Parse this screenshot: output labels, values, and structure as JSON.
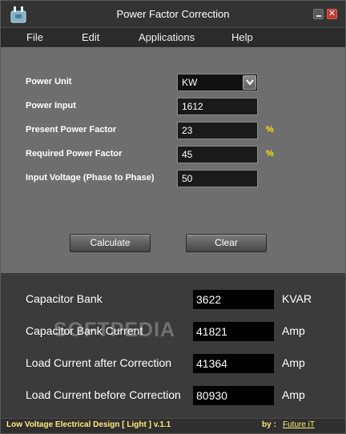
{
  "window": {
    "title": "Power Factor Correction"
  },
  "menu": {
    "items": [
      "File",
      "Edit",
      "Applications",
      "Help"
    ]
  },
  "inputs": {
    "power_unit": {
      "label": "Power Unit",
      "value": "KW"
    },
    "power_input": {
      "label": "Power Input",
      "value": "1612"
    },
    "present_pf": {
      "label": "Present Power Factor",
      "value": "23",
      "unit": "%"
    },
    "required_pf": {
      "label": "Required Power Factor",
      "value": "45",
      "unit": "%"
    },
    "input_voltage": {
      "label": "Input Voltage (Phase to Phase)",
      "value": "50"
    }
  },
  "buttons": {
    "calculate": "Calculate",
    "clear": "Clear"
  },
  "results": [
    {
      "label": "Capacitor Bank",
      "value": "3622",
      "unit": "KVAR"
    },
    {
      "label": "Capacitor Bank Current",
      "value": "41821",
      "unit": "Amp"
    },
    {
      "label": "Load Current after Correction",
      "value": "41364",
      "unit": "Amp"
    },
    {
      "label": "Load Current before Correction",
      "value": "80930",
      "unit": "Amp"
    }
  ],
  "watermark": "SOFTPEDIA",
  "status": {
    "left": "Low Voltage Electrical Design [ Light ]  v.1.1",
    "by": "by :",
    "link": "Future iT"
  },
  "colors": {
    "accent_yellow": "#ffe400",
    "panel_gray": "#6e6e6e",
    "result_bg": "#3b3b3b",
    "close_red": "#c0392b"
  }
}
